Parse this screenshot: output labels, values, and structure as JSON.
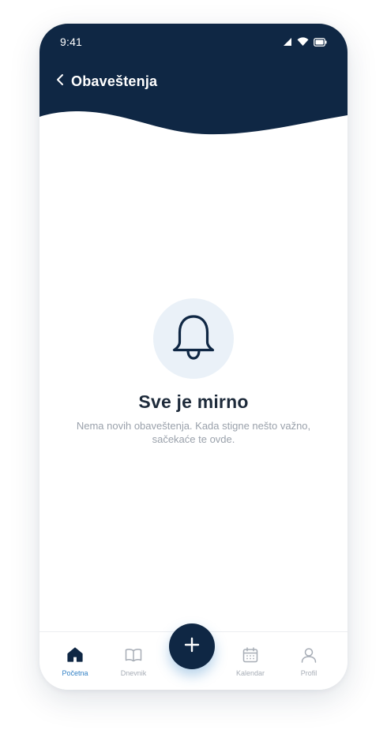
{
  "colors": {
    "header_bg": "#0f2744",
    "accent": "#2f7fc4",
    "bell_circle_bg": "#eaf1f8",
    "text_dark": "#1d2a3a",
    "text_muted": "#9aa1ab"
  },
  "status_bar": {
    "time": "9:41",
    "icons": [
      "signal-icon",
      "wifi-icon",
      "battery-icon"
    ]
  },
  "header": {
    "back_icon": "chevron-left-icon",
    "title": "Obaveštenja"
  },
  "empty_state": {
    "icon": "bell-icon",
    "title": "Sve je mirno",
    "description": "Nema novih obaveštenja. Kada stigne nešto važno, sačekaće te ovde."
  },
  "tab_bar": {
    "tabs": [
      {
        "label": "Početna",
        "icon": "home-icon",
        "active": true
      },
      {
        "label": "Dnevnik",
        "icon": "book-icon",
        "active": false
      },
      {
        "label": "Kalendar",
        "icon": "calendar-icon",
        "active": false
      },
      {
        "label": "Profil",
        "icon": "user-icon",
        "active": false
      }
    ],
    "fab_icon": "plus-icon"
  }
}
